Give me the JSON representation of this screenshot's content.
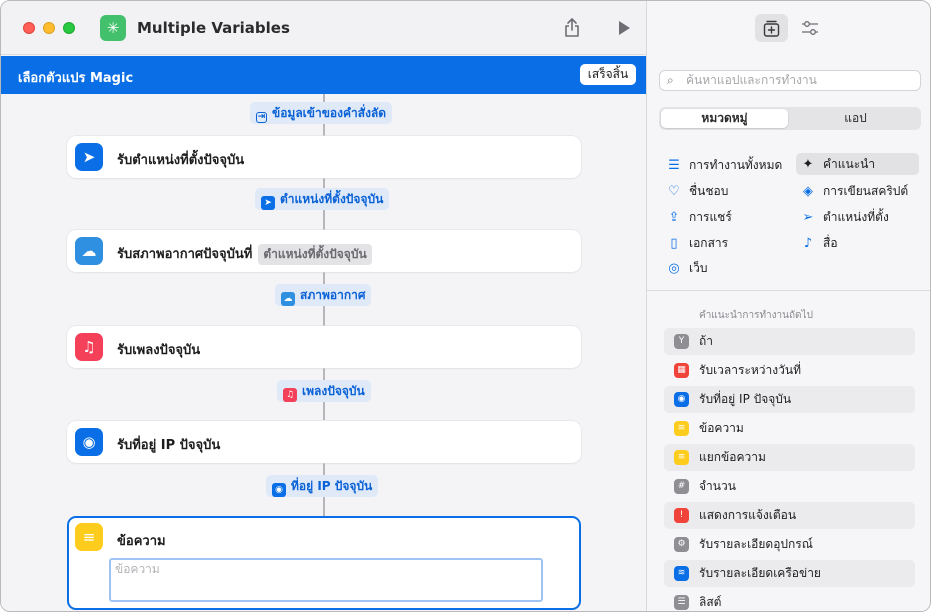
{
  "window": {
    "title": "Multiple Variables"
  },
  "magic_bar": {
    "title": "เลือกตัวแปร Magic",
    "done_label": "เสร็จสิ้น"
  },
  "workflow": {
    "input_pill": "ข้อมูลเข้าของคำสั่งลัด",
    "steps": [
      {
        "label": "รับตำแหน่งที่ตั้งปัจจุบัน",
        "icon": "location-arrow-icon",
        "color": "#0a6fe6",
        "output": "ตำแหน่งที่ตั้งปัจจุบัน"
      },
      {
        "label": "รับสภาพอากาศปัจจุบันที่",
        "token": "ตำแหน่งที่ตั้งปัจจุบัน",
        "icon": "weather-icon",
        "color": "#2f8fe0",
        "output": "สภาพอากาศ"
      },
      {
        "label": "รับเพลงปัจจุบัน",
        "icon": "music-icon",
        "color": "#f5405a",
        "output": "เพลงปัจจุบัน"
      },
      {
        "label": "รับที่อยู่ IP ปัจจุบัน",
        "icon": "globe-icon",
        "color": "#0a6fe6",
        "output": "ที่อยู่ IP ปัจจุบัน"
      }
    ],
    "text_action": {
      "label": "ข้อความ",
      "icon": "text-icon",
      "color": "#fecc1c",
      "placeholder": "ข้อความ"
    }
  },
  "sidebar": {
    "search_placeholder": "ค้นหาแอปและการทำงาน",
    "segments": [
      "หมวดหมู่",
      "แอป"
    ],
    "categories_left": [
      {
        "label": "การทำงานทั้งหมด",
        "icon": "list-icon"
      },
      {
        "label": "ชื่นชอบ",
        "icon": "heart-icon"
      },
      {
        "label": "การแชร์",
        "icon": "share-icon"
      },
      {
        "label": "เอกสาร",
        "icon": "document-icon"
      },
      {
        "label": "เว็บ",
        "icon": "compass-icon"
      }
    ],
    "categories_right": [
      {
        "label": "คำแนะนำ",
        "icon": "sparkles-icon"
      },
      {
        "label": "การเขียนสคริปต์",
        "icon": "script-icon"
      },
      {
        "label": "ตำแหน่งที่ตั้ง",
        "icon": "location-icon"
      },
      {
        "label": "สื่อ",
        "icon": "music-note-icon"
      }
    ],
    "suggestions_title": "คำแนะนำการทำงานถัดไป",
    "suggestions": [
      {
        "label": "ถ้า",
        "icon": "if-icon",
        "color": "#8e8e93"
      },
      {
        "label": "รับเวลาระหว่างวันที่",
        "icon": "calendar-icon",
        "color": "#f0433a"
      },
      {
        "label": "รับที่อยู่ IP ปัจจุบัน",
        "icon": "globe-icon",
        "color": "#0a6fe6"
      },
      {
        "label": "ข้อความ",
        "icon": "text-icon",
        "color": "#fecc1c"
      },
      {
        "label": "แยกข้อความ",
        "icon": "text-icon",
        "color": "#fecc1c"
      },
      {
        "label": "จำนวน",
        "icon": "number-icon",
        "color": "#8e8e93"
      },
      {
        "label": "แสดงการแจ้งเตือน",
        "icon": "alert-icon",
        "color": "#f0433a"
      },
      {
        "label": "รับรายละเอียดอุปกรณ์",
        "icon": "gear-icon",
        "color": "#8e8e93"
      },
      {
        "label": "รับรายละเอียดเครือข่าย",
        "icon": "wifi-icon",
        "color": "#0a6fe6"
      },
      {
        "label": "ลิสต์",
        "icon": "list-icon",
        "color": "#8e8e93"
      }
    ]
  }
}
